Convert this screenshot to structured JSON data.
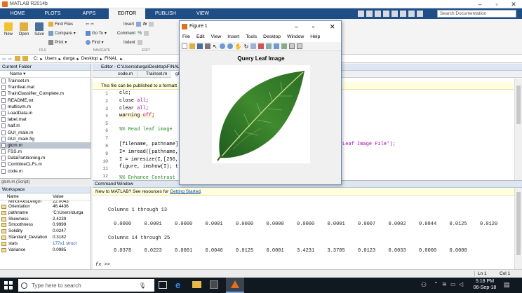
{
  "window": {
    "title": "MATLAB R2014b"
  },
  "ribbon": {
    "tabs": [
      "HOME",
      "PLOTS",
      "APPS",
      "EDITOR",
      "PUBLISH",
      "VIEW"
    ],
    "search_placeholder": "Search Documentation",
    "buttons": {
      "new": "New",
      "open": "Open",
      "save": "Save",
      "find_files": "Find Files",
      "compare": "Compare",
      "print": "Print",
      "insert": "Insert",
      "comment": "Comment",
      "indent": "Indent",
      "go_to": "Go To",
      "find": "Find"
    },
    "groups": {
      "file": "FILE",
      "navigate": "NAVIGATE",
      "edit": "EDIT"
    }
  },
  "address": {
    "parts": [
      "C:",
      "Users",
      "durga",
      "Desktop",
      "FINAL"
    ]
  },
  "current_folder": {
    "title": "Current Folder",
    "column": "Name",
    "files": [
      "Trainset.m",
      "Trainfeat.mat",
      "TrainClassifier_Complete.m",
      "README.txt",
      "multisvm.m",
      "LoadData.m",
      "label.mat",
      "half.m",
      "GUI_main.m",
      "GUI_main.fig",
      "glcm.m",
      "FSS.m",
      "DataPartitioning.m",
      "CombineCLFs.m",
      "code.m"
    ],
    "selected_index": 10,
    "status": "glcm.m (Script)"
  },
  "workspace": {
    "title": "Workspace",
    "col_name": "Name",
    "col_value": "Value",
    "partial_top_name": "MinorAxisLength",
    "partial_top_value": "22.0043",
    "rows": [
      {
        "name": "Orientation",
        "value": "46.4436"
      },
      {
        "name": "pathname",
        "value": "'C:\\Users\\durga"
      },
      {
        "name": "Skewness",
        "value": "2.4239"
      },
      {
        "name": "Smoothness",
        "value": "0.9999"
      },
      {
        "name": "Solidity",
        "value": "0.0247"
      },
      {
        "name": "Standard_Deviation",
        "value": "0.3182"
      },
      {
        "name": "stats",
        "value": "177x1 struct"
      },
      {
        "name": "Variance",
        "value": "0.0985"
      }
    ]
  },
  "editor": {
    "title": "Editor - C:\\Users\\durga\\Desktop\\FINAL",
    "tabs": [
      "code.m",
      "Trainset.m",
      "glcm"
    ],
    "publish_bar": "This file can be published to a formatt",
    "line_numbers": [
      "1",
      "2",
      "3",
      "4",
      "5",
      "6",
      "7",
      "8",
      "9",
      "10",
      "11",
      "12"
    ],
    "code": {
      "l1": "clc;",
      "l2_kw": "close ",
      "l2_arg": "all",
      "l3_kw": "clear ",
      "l3_arg": "all",
      "l4_kw": "warning ",
      "l4_arg": "off",
      "l6": "%% Read leaf image",
      "l8": "[filename, pathname]",
      "l8_tail": "Leaf Image File');",
      "l9": "I= imread([pathname,",
      "l10": "I = imresize(I,[256,",
      "l11": "figure, imshow(I); t",
      "l13": "%% Enhance Contrast"
    }
  },
  "figure": {
    "title": "Figure 1",
    "menu": [
      "File",
      "Edit",
      "View",
      "Insert",
      "Tools",
      "Desktop",
      "Window",
      "Help"
    ],
    "plot_title": "Query Leaf Image"
  },
  "command_window": {
    "title": "Command Window",
    "new_prefix": "New to MATLAB? See resources for ",
    "new_link": "Getting Started",
    "new_suffix": ".",
    "header1": "Columns 1 through 13",
    "values1": [
      "0.0000",
      "0.0001",
      "0.0000",
      "0.0001",
      "0.0000",
      "0.0000",
      "0.0000",
      "0.0001",
      "0.0007",
      "0.0002",
      "0.0844",
      "0.0125",
      "0.0120"
    ],
    "header2": "Columns 14 through 25",
    "values2": [
      "0.0378",
      "0.0223",
      "0.0001",
      "0.0046",
      "0.0125",
      "0.0001",
      "3.4231",
      "3.3705",
      "0.0123",
      "0.0033",
      "0.0000",
      "0.0000"
    ],
    "prompt": "fx >>"
  },
  "status_bar": {
    "ln": "Ln 1",
    "col": "Col 1"
  },
  "taskbar": {
    "search": "Type here to search",
    "time": "5:18 PM",
    "date": "06-Sep-18"
  }
}
